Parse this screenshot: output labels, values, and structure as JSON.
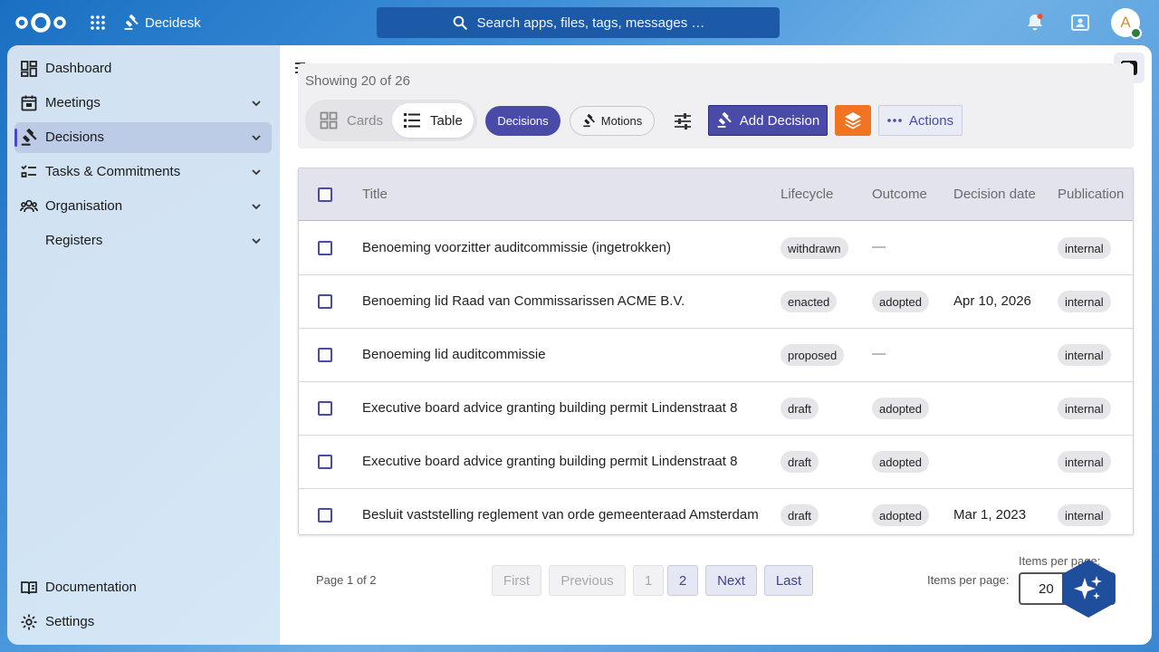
{
  "header": {
    "app_name": "Decidesk",
    "search_placeholder": "Search apps, files, tags, messages …",
    "avatar_initial": "A"
  },
  "sidebar": {
    "items": [
      {
        "label": "Dashboard",
        "icon": "dashboard-icon",
        "expandable": false
      },
      {
        "label": "Meetings",
        "icon": "calendar-icon",
        "expandable": true
      },
      {
        "label": "Decisions",
        "icon": "gavel-icon",
        "expandable": true,
        "active": true
      },
      {
        "label": "Tasks & Commitments",
        "icon": "checklist-icon",
        "expandable": true
      },
      {
        "label": "Organisation",
        "icon": "people-icon",
        "expandable": true
      },
      {
        "label": "Registers",
        "icon": "",
        "expandable": true
      }
    ],
    "footer": [
      {
        "label": "Documentation",
        "icon": "book-icon"
      },
      {
        "label": "Settings",
        "icon": "gear-icon"
      }
    ]
  },
  "toolbar": {
    "showing": "Showing 20 of 26",
    "view_cards": "Cards",
    "view_table": "Table",
    "active_view": "Table",
    "filter_decisions": "Decisions",
    "filter_motions": "Motions",
    "add_label": "Add Decision",
    "actions_label": "Actions"
  },
  "table": {
    "columns": [
      "Title",
      "Lifecycle",
      "Outcome",
      "Decision date",
      "Publication"
    ],
    "rows": [
      {
        "title": "Benoeming voorzitter auditcommissie (ingetrokken)",
        "lifecycle": "withdrawn",
        "outcome": "—",
        "date": "",
        "publication": "internal"
      },
      {
        "title": "Benoeming lid Raad van Commissarissen ACME B.V.",
        "lifecycle": "enacted",
        "outcome": "adopted",
        "date": "Apr 10, 2026",
        "publication": "internal"
      },
      {
        "title": "Benoeming lid auditcommissie",
        "lifecycle": "proposed",
        "outcome": "—",
        "date": "",
        "publication": "internal"
      },
      {
        "title": "Executive board advice granting building permit Lindenstraat 8",
        "lifecycle": "draft",
        "outcome": "adopted",
        "date": "",
        "publication": "internal"
      },
      {
        "title": "Executive board advice granting building permit Lindenstraat 8",
        "lifecycle": "draft",
        "outcome": "adopted",
        "date": "",
        "publication": "internal"
      },
      {
        "title": "Besluit vaststelling reglement van orde gemeenteraad Amsterdam",
        "lifecycle": "draft",
        "outcome": "adopted",
        "date": "Mar 1, 2023",
        "publication": "internal"
      }
    ]
  },
  "pagination": {
    "info": "Page 1 of 2",
    "first": "First",
    "previous": "Previous",
    "page1": "1",
    "page2": "2",
    "next": "Next",
    "last": "Last",
    "items_per_page_label": "Items per page:",
    "items_per_page_value": "20"
  },
  "colors": {
    "primary": "#4a4aa8",
    "accent_orange": "#f07422",
    "header_bg": "#2a78c9"
  }
}
